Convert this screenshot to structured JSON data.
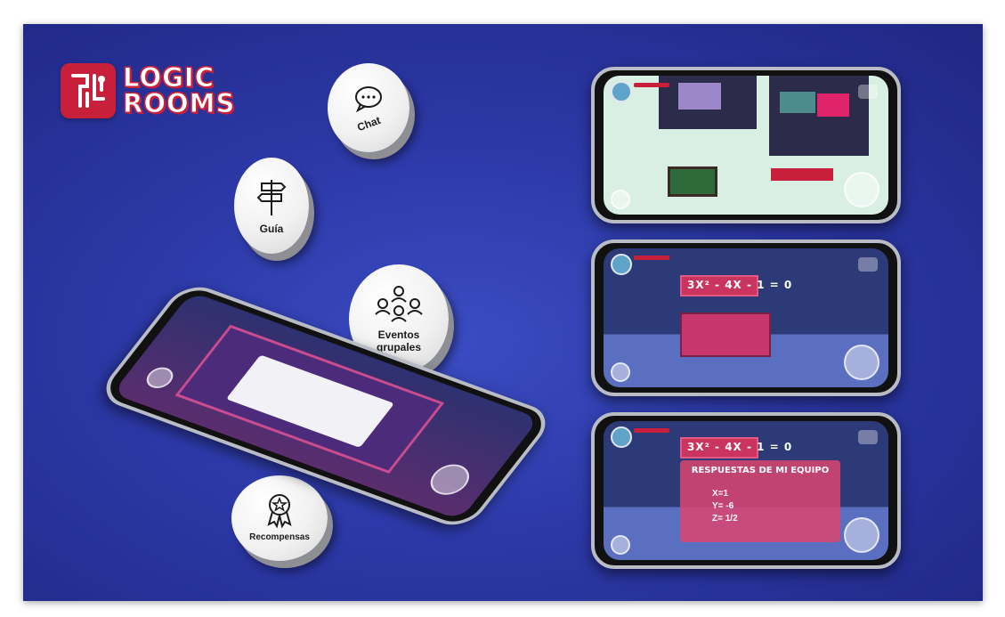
{
  "brand": {
    "line1": "LOGIC",
    "line2": "ROOMS",
    "color": "#c8203a"
  },
  "features": [
    {
      "id": "chat",
      "label": "Chat",
      "icon": "chat-bubble-icon"
    },
    {
      "id": "guide",
      "label": "Guía",
      "icon": "signpost-icon"
    },
    {
      "id": "events",
      "label": "Eventos grupales",
      "icon": "group-icon"
    },
    {
      "id": "rewards",
      "label": "Recompensas",
      "icon": "award-badge-icon"
    }
  ],
  "puzzle": {
    "equation": "3X² - 4X - 1 = 0"
  },
  "team_answers": {
    "title": "RESPUESTAS DE MI EQUIPO",
    "answers": [
      "X=1",
      "Y= -6",
      "Z= 1/2"
    ]
  },
  "colors": {
    "background": "#2c38a6",
    "accent": "#c8203a"
  }
}
